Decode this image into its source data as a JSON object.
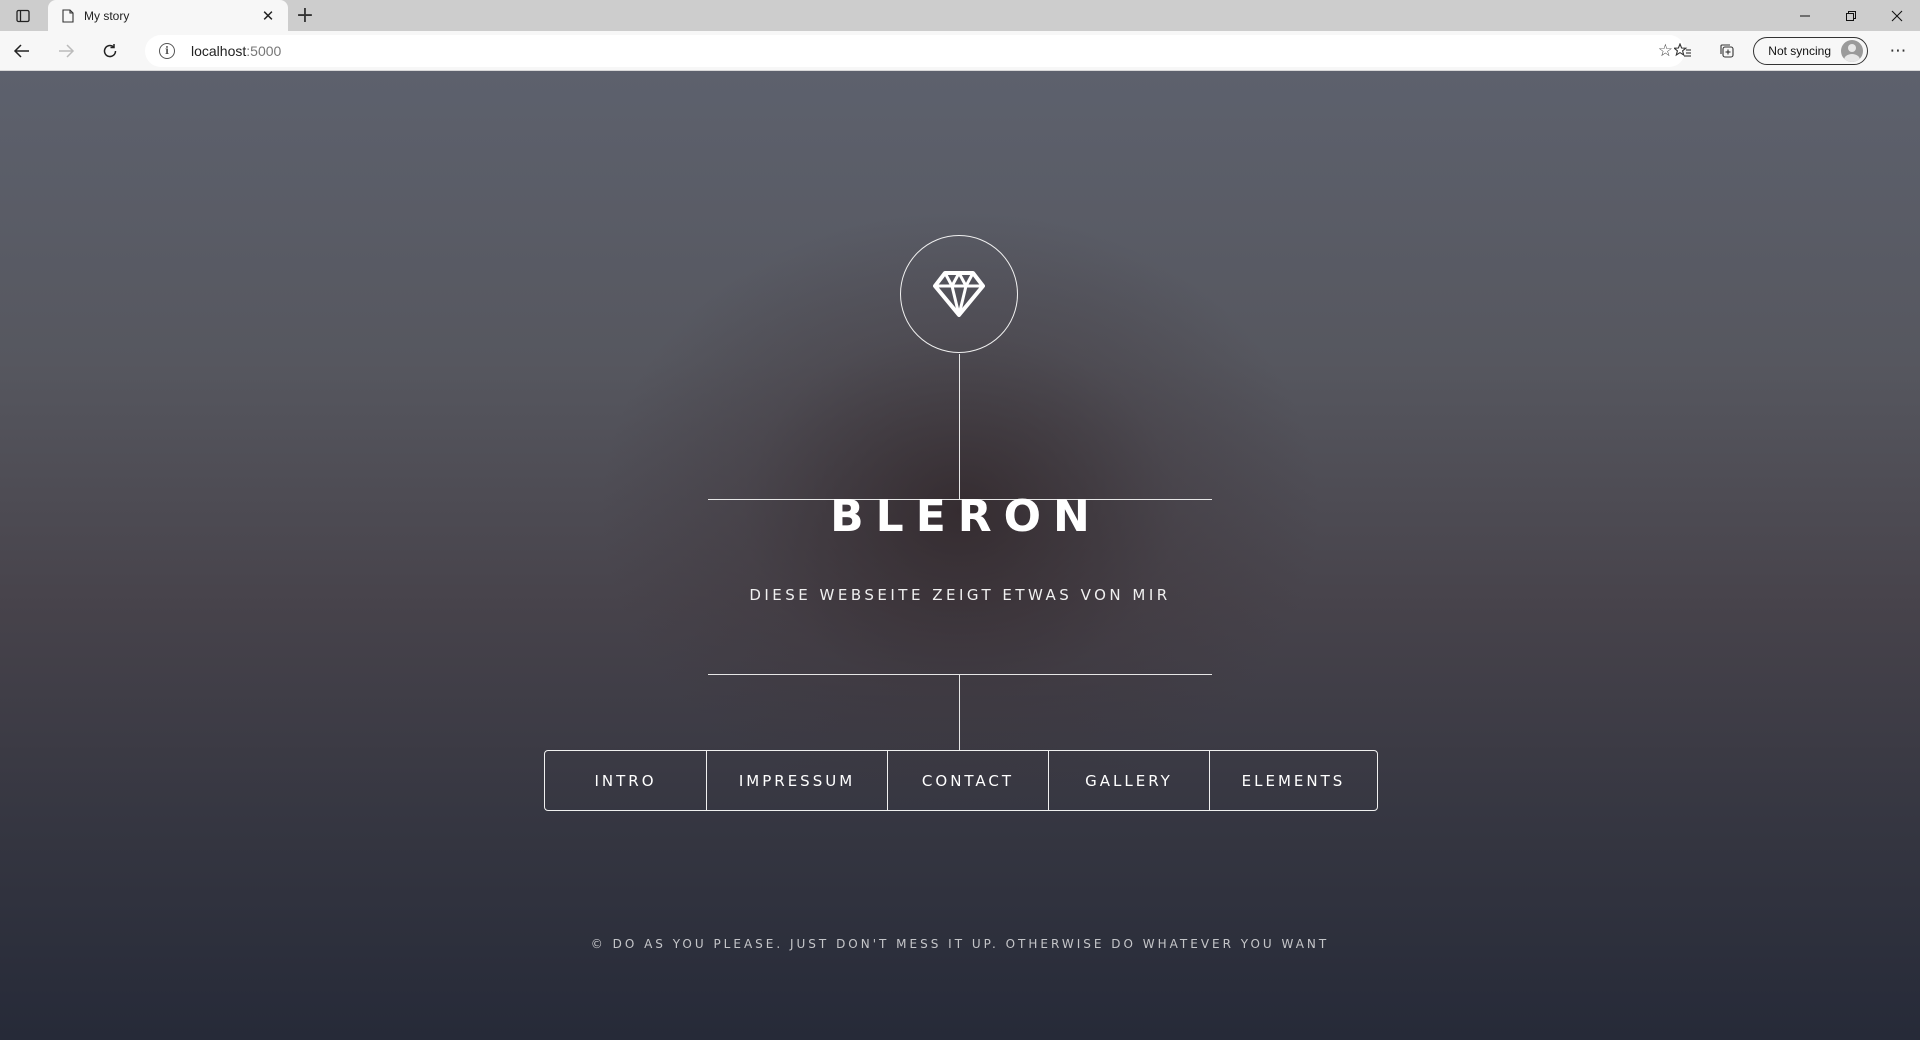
{
  "browser": {
    "tab_title": "My story",
    "new_tab": "+",
    "url_host": "localhost",
    "url_port": ":5000",
    "profile_label": "Not syncing"
  },
  "site": {
    "title": "BLERON",
    "subtitle": "DIESE WEBSEITE ZEIGT ETWAS VON MIR",
    "footer": "© DO AS YOU PLEASE. JUST DON'T MESS IT UP. OTHERWISE DO WHATEVER YOU WANT",
    "logo_icon": "diamond-icon"
  },
  "nav": {
    "items": [
      {
        "label": "INTRO"
      },
      {
        "label": "IMPRESSUM"
      },
      {
        "label": "CONTACT"
      },
      {
        "label": "GALLERY"
      },
      {
        "label": "ELEMENTS"
      }
    ]
  },
  "colors": {
    "line": "#e6e6e6",
    "text": "#ffffff",
    "bg_top": "#5d616d",
    "bg_bottom": "#262a38"
  }
}
